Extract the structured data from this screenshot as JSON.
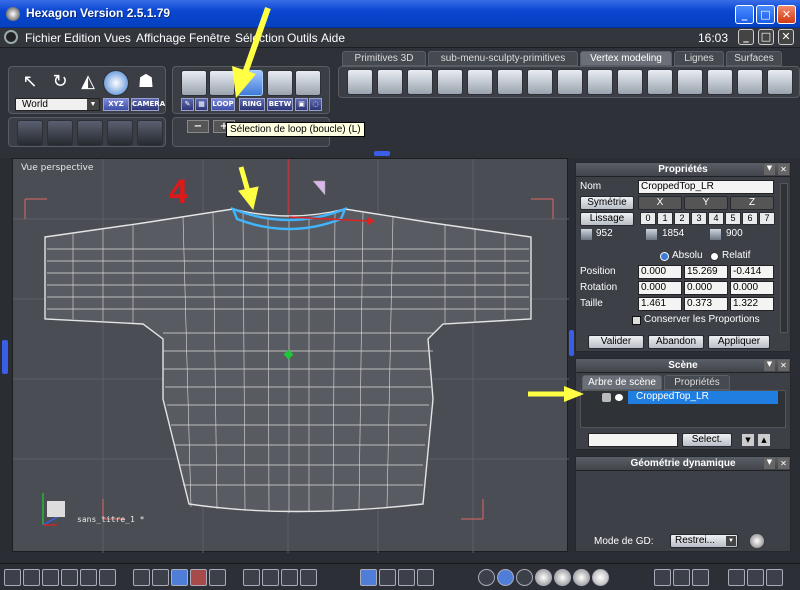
{
  "window": {
    "title": "Hexagon Version 2.5.1.79",
    "clock": "16:03"
  },
  "menu": [
    "Fichier",
    "Edition",
    "Vues",
    "Affichage",
    "Fenêtre",
    "Sélection",
    "Outils",
    "Aide"
  ],
  "tabs": [
    "Primitives 3D",
    "sub-menu-sculpty-primitives",
    "Vertex modeling",
    "Lignes",
    "Surfaces"
  ],
  "active_tab": "Vertex modeling",
  "toolbar": {
    "coord_select": "World",
    "xyz_label": "XYZ",
    "camera_label": "CAMERA",
    "selection_modes": [
      "LOOP",
      "RING",
      "BETW"
    ],
    "zoom_minus": "−",
    "zoom_plus": "+"
  },
  "tooltip": "Sélection de loop (boucle) (L)",
  "viewport": {
    "label": "Vue perspective",
    "annotation_number": "4",
    "file_label": "sans_titre_1 *"
  },
  "properties": {
    "title": "Propriétés",
    "name_label": "Nom",
    "name_value": "CroppedTop_LR",
    "symmetry_label": "Symétrie",
    "axes": [
      "X",
      "Y",
      "Z"
    ],
    "smoothing_label": "Lissage",
    "smoothing_levels": [
      "0",
      "1",
      "2",
      "3",
      "4",
      "5",
      "6",
      "7"
    ],
    "counts": [
      "952",
      "1854",
      "900"
    ],
    "absolute_label": "Absolu",
    "relative_label": "Relatif",
    "position_label": "Position",
    "position": [
      "0.000",
      "15.269",
      "-0.414"
    ],
    "rotation_label": "Rotation",
    "rotation": [
      "0.000",
      "0.000",
      "0.000"
    ],
    "size_label": "Taille",
    "size": [
      "1.461",
      "0.373",
      "1.322"
    ],
    "keep_proportions_label": "Conserver les Proportions",
    "validate_label": "Valider",
    "abandon_label": "Abandon",
    "apply_label": "Appliquer"
  },
  "scene": {
    "title": "Scène",
    "tabs": [
      "Arbre de scène",
      "Propriétés"
    ],
    "item": "CroppedTop_LR",
    "select_label": "Select."
  },
  "dyn_geometry": {
    "title": "Géométrie dynamique",
    "mode_label": "Mode de GD:",
    "mode_value": "Restrei..."
  },
  "colors": {
    "accent_blue": "#1f7ee0",
    "loop_cyan": "#3fb6ff",
    "annotation_yellow": "#ffff44",
    "annotation_red": "#e01818"
  }
}
